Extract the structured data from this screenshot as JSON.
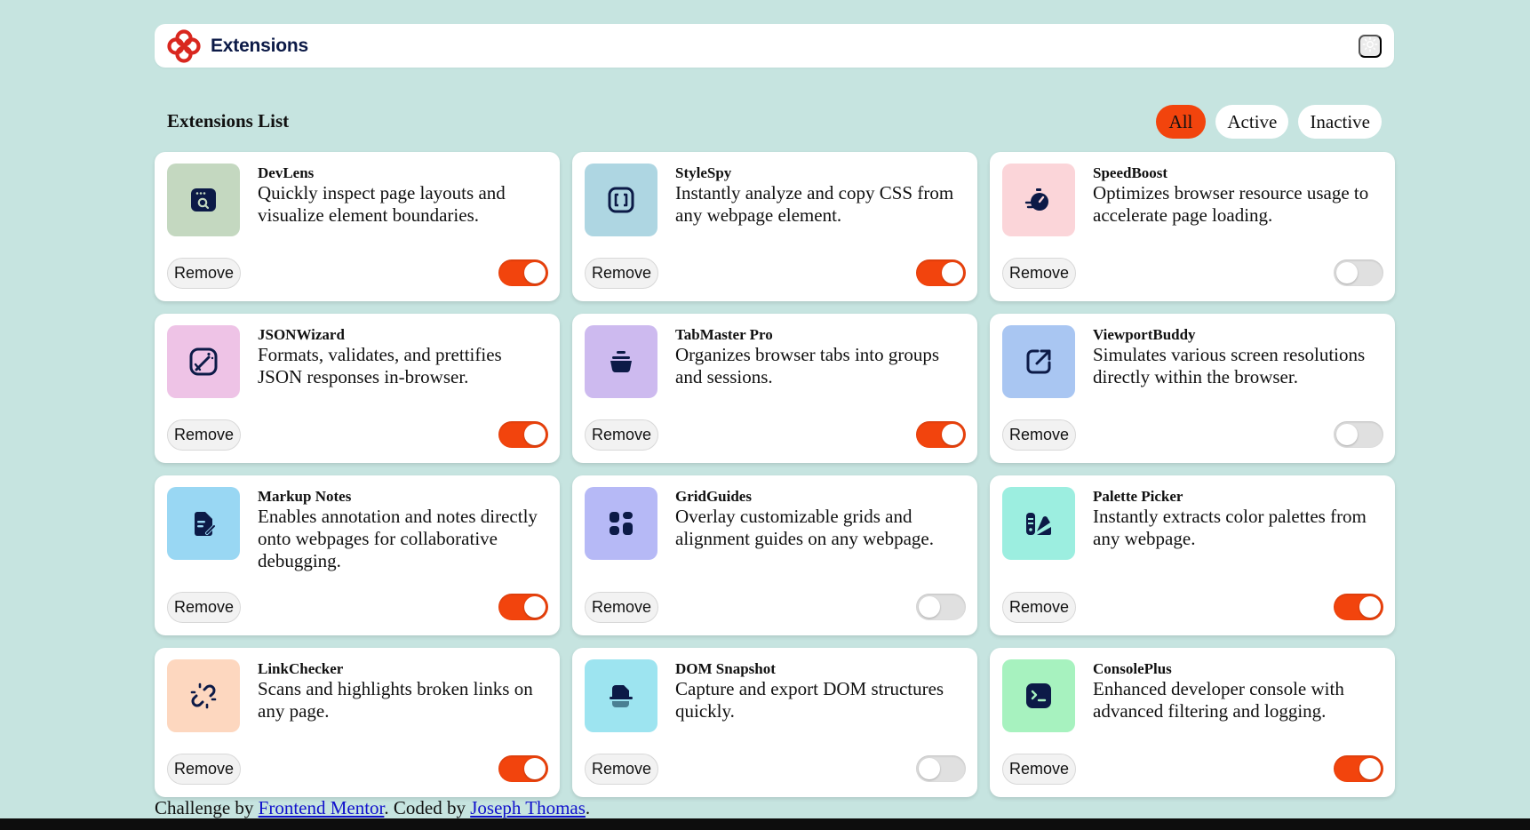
{
  "app": {
    "title": "Extensions",
    "logo_icon": "logo-icon",
    "theme_icon": "sun-icon",
    "accent": "#f2440d",
    "background": "#c6e4e0"
  },
  "list": {
    "title": "Extensions List",
    "filters": [
      {
        "label": "All",
        "active": true
      },
      {
        "label": "Active",
        "active": false
      },
      {
        "label": "Inactive",
        "active": false
      }
    ]
  },
  "extensions": [
    {
      "name": "DevLens",
      "description": "Quickly inspect page layouts and visualize element boundaries.",
      "icon": "devlens-icon",
      "tile_color": "#c4d8c0",
      "enabled": true,
      "remove_label": "Remove"
    },
    {
      "name": "StyleSpy",
      "description": "Instantly analyze and copy CSS from any webpage element.",
      "icon": "stylespy-icon",
      "tile_color": "#aed6e2",
      "enabled": true,
      "remove_label": "Remove"
    },
    {
      "name": "SpeedBoost",
      "description": "Optimizes browser resource usage to accelerate page loading.",
      "icon": "speedboost-icon",
      "tile_color": "#fbd5d9",
      "enabled": false,
      "remove_label": "Remove"
    },
    {
      "name": "JSONWizard",
      "description": "Formats, validates, and prettifies JSON responses in-browser.",
      "icon": "jsonwizard-icon",
      "tile_color": "#eec3e6",
      "enabled": true,
      "remove_label": "Remove"
    },
    {
      "name": "TabMaster Pro",
      "description": "Organizes browser tabs into groups and sessions.",
      "icon": "tabmaster-icon",
      "tile_color": "#cdbaef",
      "enabled": true,
      "remove_label": "Remove"
    },
    {
      "name": "ViewportBuddy",
      "description": "Simulates various screen resolutions directly within the browser.",
      "icon": "viewportbuddy-icon",
      "tile_color": "#a9c6f2",
      "enabled": false,
      "remove_label": "Remove"
    },
    {
      "name": "Markup Notes",
      "description": "Enables annotation and notes directly onto webpages for collaborative debugging.",
      "icon": "markupnotes-icon",
      "tile_color": "#99d7f3",
      "enabled": true,
      "remove_label": "Remove"
    },
    {
      "name": "GridGuides",
      "description": "Overlay customizable grids and alignment guides on any webpage.",
      "icon": "gridguides-icon",
      "tile_color": "#b6b9f6",
      "enabled": false,
      "remove_label": "Remove"
    },
    {
      "name": "Palette Picker",
      "description": "Instantly extracts color palettes from any webpage.",
      "icon": "palettepicker-icon",
      "tile_color": "#9ceee0",
      "enabled": true,
      "remove_label": "Remove"
    },
    {
      "name": "LinkChecker",
      "description": "Scans and highlights broken links on any page.",
      "icon": "linkchecker-icon",
      "tile_color": "#fdd7bf",
      "enabled": true,
      "remove_label": "Remove"
    },
    {
      "name": "DOM Snapshot",
      "description": "Capture and export DOM structures quickly.",
      "icon": "domsnapshot-icon",
      "tile_color": "#9de4f0",
      "enabled": false,
      "remove_label": "Remove"
    },
    {
      "name": "ConsolePlus",
      "description": "Enhanced developer console with advanced filtering and logging.",
      "icon": "consoleplus-icon",
      "tile_color": "#a7f2bf",
      "enabled": true,
      "remove_label": "Remove"
    }
  ],
  "footer": {
    "prefix": "Challenge by ",
    "link1": "Frontend Mentor",
    "middle": ". Coded by ",
    "link2": "Joseph Thomas",
    "suffix": "."
  }
}
